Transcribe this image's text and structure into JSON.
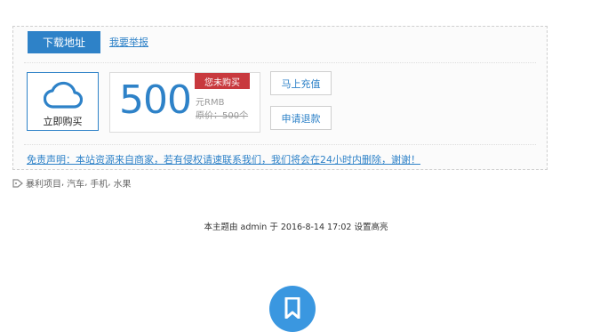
{
  "panel": {
    "download_label": "下载地址",
    "report_label": "我要举报",
    "buy_label": "立即购买",
    "price": "500",
    "status_badge": "您未购买",
    "unit": "元RMB",
    "original_price": "原价：500个",
    "recharge_label": "马上充值",
    "refund_label": "申请退款",
    "disclaimer": "免责声明：本站资源来自商家，若有侵权请速联系我们，我们将会在24小时内删除，谢谢！"
  },
  "tags": [
    "暴利项目",
    "汽车",
    "手机",
    "水果"
  ],
  "notice": "本主题由 admin 于 2016-8-14 17:02 设置高亮",
  "colors": {
    "accent": "#2e82c8",
    "badge": "#c8393e",
    "fav": "#3a97e0"
  },
  "icons": {
    "buy": "cloud-icon",
    "tags": "tag-icon",
    "favorite": "bookmark-icon"
  }
}
